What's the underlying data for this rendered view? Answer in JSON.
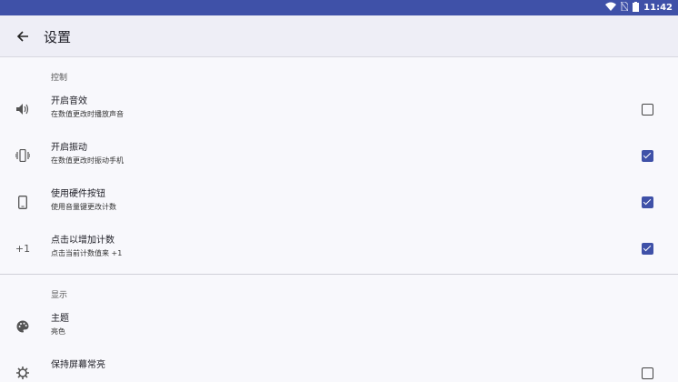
{
  "status_bar": {
    "time": "11:42",
    "icons": [
      "wifi-icon",
      "no-sim-icon",
      "battery-icon"
    ]
  },
  "app_bar": {
    "title": "设置",
    "back_icon": "arrow-back-icon"
  },
  "sections": [
    {
      "header": "控制",
      "items": [
        {
          "label": "开启音效",
          "summary": "在数值更改时播放声音",
          "icon": "volume-icon",
          "checked": false
        },
        {
          "label": "开启振动",
          "summary": "在数值更改时振动手机",
          "icon": "vibrate-icon",
          "checked": true
        },
        {
          "label": "使用硬件按钮",
          "summary": "使用音量键更改计数",
          "icon": "phone-icon",
          "checked": true
        },
        {
          "label": "点击以增加计数",
          "summary": "点击当前计数值来 +1",
          "icon": "plus-one-icon",
          "icon_text": "+1",
          "checked": true
        }
      ]
    },
    {
      "header": "显示",
      "items": [
        {
          "label": "主题",
          "summary": "亮色",
          "icon": "palette-icon"
        },
        {
          "label": "保持屏幕常亮",
          "summary": "",
          "icon": "gear-icon",
          "checked": false
        }
      ]
    }
  ],
  "colors": {
    "status_bar": "#3f51a8",
    "accent": "#3f51a8",
    "background": "#f8f8fc"
  }
}
